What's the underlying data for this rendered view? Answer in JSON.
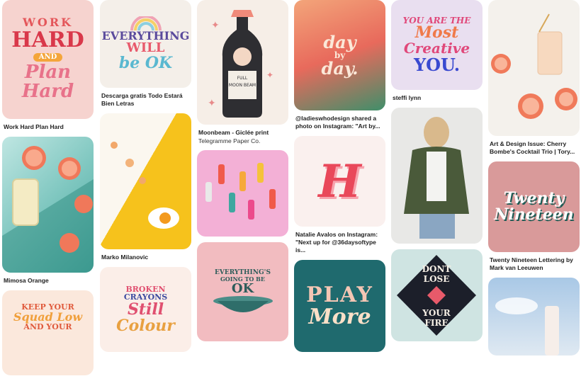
{
  "pins": {
    "work_hard": {
      "caption": "Work Hard Plan Hard",
      "art_line1": "WORK",
      "art_line2": "HARD",
      "art_line3": "AND",
      "art_line4": "Plan",
      "art_line5": "Hard"
    },
    "mimosa": {
      "caption": "Mimosa Orange"
    },
    "keep_your": {
      "art_line1": "KEEP YOUR",
      "art_line2": "Squad Low",
      "art_line3": "AND YOUR"
    },
    "todo_estara": {
      "caption": "Descarga gratis Todo Estará Bien Letras",
      "art_line1": "EVERYTHING",
      "art_line2": "WILL",
      "art_line3": "be OK"
    },
    "marko": {
      "caption": "Marko Milanovic"
    },
    "broken_crayons": {
      "art_line1": "BROKEN",
      "art_line2": "CRAYONS",
      "art_line3": "Still",
      "art_line4": "Colour"
    },
    "moonbeam": {
      "caption": "Moonbeam - Giclée print",
      "subcaption": "Telegramme Paper Co.",
      "label_top": "FULL",
      "label_mid": "MOON BEAM"
    },
    "sticks": {},
    "everything_ok_cup": {
      "art_line1": "EVERYTHING'S",
      "art_line2": "GOING TO BE",
      "art_line3": "OK"
    },
    "day_by_day": {
      "caption": "@ladieswhodesign shared a photo on Instagram: \"Art by...",
      "art_line1": "day",
      "art_line2": "by",
      "art_line3": "day."
    },
    "natalie": {
      "caption": "Natalie Avalos on Instagram: \"Next up for @36daysoftype is...",
      "art_letter": "H"
    },
    "play_more": {
      "art_line1": "PLAY",
      "art_line2": "More"
    },
    "most_creative": {
      "caption": "steffi lynn",
      "art_line1": "YOU ARE THE",
      "art_line2": "Most",
      "art_line3": "Creative",
      "art_line4": "YOU."
    },
    "jacket": {},
    "dont_lose": {
      "art_line1": "DONT",
      "art_line2": "LOSE",
      "art_line3": "YOUR",
      "art_line4": "FIRE"
    },
    "cherry_bombe": {
      "caption": "Art & Design Issue: Cherry Bombe's Cocktail Trio | Tory..."
    },
    "twenty_nineteen": {
      "caption": "Twenty Nineteen Lettering by Mark van Leeuwen",
      "art_line1": "Twenty",
      "art_line2": "Nineteen"
    },
    "sky": {}
  }
}
